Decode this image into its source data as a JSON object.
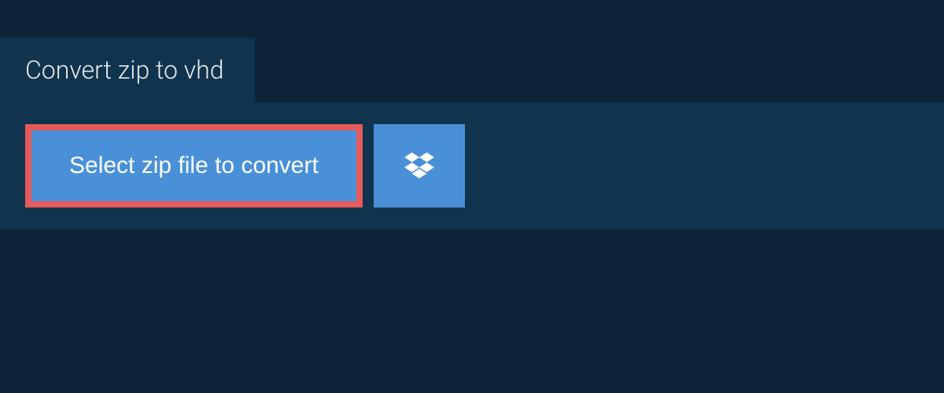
{
  "header": {
    "title": "Convert zip to vhd"
  },
  "actions": {
    "select_file_label": "Select zip file to convert"
  },
  "colors": {
    "background": "#0d2438",
    "panel": "#10344e",
    "highlight_border": "#e55a5a",
    "button": "#4a90d9",
    "text_light": "#e8e8e8",
    "text_white": "#ffffff"
  }
}
